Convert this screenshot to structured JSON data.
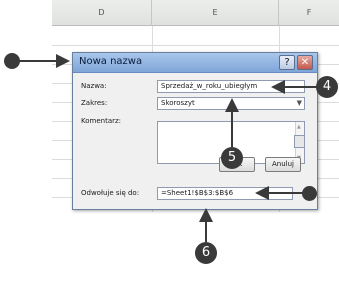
{
  "sheet": {
    "columns": [
      "D",
      "E",
      "F"
    ]
  },
  "dialog": {
    "title": "Nowa nazwa",
    "help_glyph": "?",
    "close_glyph": "✕",
    "name_label": "Nazwa:",
    "name_value": "Sprzedaż_w_roku_ubiegłym",
    "scope_label": "Zakres:",
    "scope_value": "Skoroszyt",
    "comment_label": "Komentarz:",
    "refers_label": "Odwołuje się do:",
    "refers_value": "=Sheet1!$B$3:$B$6",
    "ok_label": "OK",
    "cancel_label": "Anuluj"
  },
  "callouts": {
    "badge_4": "4",
    "badge_5": "5",
    "badge_6": "6"
  },
  "colors": {
    "callout": "#3a3a3a",
    "titlebar": "#8fb3e3"
  }
}
